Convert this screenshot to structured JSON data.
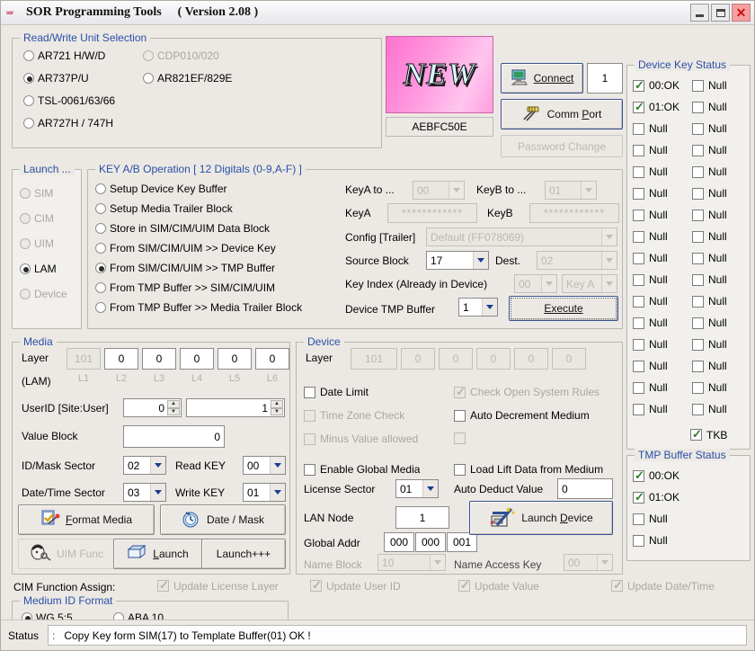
{
  "window": {
    "title": "SOR Programming Tools",
    "version": "( Version 2.08 )",
    "logo": "sor",
    "minimize": "minimize-icon",
    "maximize": "maximize-icon",
    "close": "✕"
  },
  "unit_selection": {
    "caption": "Read/Write Unit Selection",
    "options": [
      {
        "label": "AR721 H/W/D",
        "checked": false,
        "disabled": false
      },
      {
        "label": "AR737P/U",
        "checked": true,
        "disabled": false
      },
      {
        "label": "TSL-0061/63/66",
        "checked": false,
        "disabled": false
      },
      {
        "label": "AR727H / 747H",
        "checked": false,
        "disabled": false
      }
    ],
    "options_right": [
      {
        "label": "CDP010/020",
        "checked": false,
        "disabled": true
      },
      {
        "label": "AR821EF/829E",
        "checked": false,
        "disabled": false
      }
    ]
  },
  "device_panel": {
    "badge": "NEW",
    "serial": "AEBFC50E",
    "connect_label": "Connect",
    "connect_icon": "monitor-icon",
    "connect_value": "1",
    "commport_label": "Comm Port",
    "commport_icon": "plug-icon",
    "password_label": "Password Change"
  },
  "device_key_status": {
    "caption": "Device Key Status",
    "rows": [
      {
        "left": {
          "label": "00:OK",
          "checked": true
        },
        "right": {
          "label": "Null",
          "checked": false
        }
      },
      {
        "left": {
          "label": "01:OK",
          "checked": true
        },
        "right": {
          "label": "Null",
          "checked": false
        }
      },
      {
        "left": {
          "label": "Null",
          "checked": false
        },
        "right": {
          "label": "Null",
          "checked": false
        }
      },
      {
        "left": {
          "label": "Null",
          "checked": false
        },
        "right": {
          "label": "Null",
          "checked": false
        }
      },
      {
        "left": {
          "label": "Null",
          "checked": false
        },
        "right": {
          "label": "Null",
          "checked": false
        }
      },
      {
        "left": {
          "label": "Null",
          "checked": false
        },
        "right": {
          "label": "Null",
          "checked": false
        }
      },
      {
        "left": {
          "label": "Null",
          "checked": false
        },
        "right": {
          "label": "Null",
          "checked": false
        }
      },
      {
        "left": {
          "label": "Null",
          "checked": false
        },
        "right": {
          "label": "Null",
          "checked": false
        }
      },
      {
        "left": {
          "label": "Null",
          "checked": false
        },
        "right": {
          "label": "Null",
          "checked": false
        }
      },
      {
        "left": {
          "label": "Null",
          "checked": false
        },
        "right": {
          "label": "Null",
          "checked": false
        }
      },
      {
        "left": {
          "label": "Null",
          "checked": false
        },
        "right": {
          "label": "Null",
          "checked": false
        }
      },
      {
        "left": {
          "label": "Null",
          "checked": false
        },
        "right": {
          "label": "Null",
          "checked": false
        }
      },
      {
        "left": {
          "label": "Null",
          "checked": false
        },
        "right": {
          "label": "Null",
          "checked": false
        }
      },
      {
        "left": {
          "label": "Null",
          "checked": false
        },
        "right": {
          "label": "Null",
          "checked": false
        }
      },
      {
        "left": {
          "label": "Null",
          "checked": false
        },
        "right": {
          "label": "Null",
          "checked": false
        }
      },
      {
        "left": {
          "label": "Null",
          "checked": false
        },
        "right": {
          "label": "Null",
          "checked": false
        }
      }
    ],
    "tkb": {
      "label": "TKB",
      "checked": true
    }
  },
  "tmp_buffer_status": {
    "caption": "TMP Buffer Status",
    "rows": [
      {
        "label": "00:OK",
        "checked": true
      },
      {
        "label": "01:OK",
        "checked": true
      },
      {
        "label": "Null",
        "checked": false
      },
      {
        "label": "Null",
        "checked": false
      }
    ]
  },
  "launch": {
    "caption": "Launch ...",
    "options": [
      {
        "label": "SIM",
        "checked": false,
        "disabled": true
      },
      {
        "label": "CIM",
        "checked": false,
        "disabled": true
      },
      {
        "label": "UIM",
        "checked": false,
        "disabled": true
      },
      {
        "label": "LAM",
        "checked": true,
        "disabled": false
      },
      {
        "label": "Device",
        "checked": false,
        "disabled": true
      }
    ]
  },
  "key_ab": {
    "caption": "KEY A/B Operation   [ 12 Digitals (0-9,A-F) ]",
    "options": [
      {
        "label": "Setup Device Key Buffer",
        "checked": false
      },
      {
        "label": "Setup Media Trailer Block",
        "checked": false
      },
      {
        "label": "Store in SIM/CIM/UIM Data Block",
        "checked": false
      },
      {
        "label": "From SIM/CIM/UIM  >> Device Key",
        "checked": false
      },
      {
        "label": "From SIM/CIM/UIM  >> TMP Buffer",
        "checked": true
      },
      {
        "label": "From TMP Buffer >> SIM/CIM/UIM",
        "checked": false
      },
      {
        "label": "From TMP Buffer >> Media Trailer Block",
        "checked": false
      }
    ],
    "keya_to_label": "KeyA  to ...",
    "keya_to_value": "00",
    "keyb_to_label": "KeyB  to ...",
    "keyb_to_value": "01",
    "keya_label": "KeyA",
    "keya_value": "************",
    "keyb_label": "KeyB",
    "keyb_value": "************",
    "config_label": "Config [Trailer]",
    "config_value": "Default (FF078069)",
    "source_label": "Source Block",
    "source_value": "17",
    "dest_label": "Dest.",
    "dest_value": "02",
    "keyindex_label": "Key Index (Already in Device)",
    "keyindex_value": "00",
    "keytype_value": "Key A",
    "tmpbuffer_label": "Device TMP Buffer",
    "tmpbuffer_value": "1",
    "execute_label": "Execute"
  },
  "media": {
    "caption": "Media",
    "layer_label": "Layer",
    "lam_label": "(LAM)",
    "layer_cells": [
      {
        "value": "101",
        "disabled": true,
        "tag": "L1"
      },
      {
        "value": "0",
        "disabled": false,
        "tag": "L2"
      },
      {
        "value": "0",
        "disabled": false,
        "tag": "L3"
      },
      {
        "value": "0",
        "disabled": false,
        "tag": "L4"
      },
      {
        "value": "0",
        "disabled": false,
        "tag": "L5"
      },
      {
        "value": "0",
        "disabled": false,
        "tag": "L6"
      }
    ],
    "userid_label": "UserID [Site:User]",
    "userid_site": "0",
    "userid_user": "1",
    "valueblock_label": "Value Block",
    "valueblock_value": "0",
    "idmask_label": "ID/Mask Sector",
    "idmask_value": "02",
    "readkey_label": "Read KEY",
    "readkey_value": "00",
    "datetime_label": "Date/Time Sector",
    "datetime_value": "03",
    "writekey_label": "Write KEY",
    "writekey_value": "01",
    "format_media_label": "Format Media",
    "format_media_icon": "form-check-icon",
    "date_mask_label": "Date / Mask",
    "date_mask_icon": "clock-icon",
    "uim_func_label": "UIM Func",
    "uim_func_icon": "face-key-icon",
    "launch_label": "Launch",
    "launch_icon": "window-icon",
    "launch_plus_label": "Launch+++"
  },
  "device": {
    "caption": "Device",
    "layer_label": "Layer",
    "layer_cells": [
      {
        "value": "101",
        "disabled": true
      },
      {
        "value": "0",
        "disabled": true
      },
      {
        "value": "0",
        "disabled": true
      },
      {
        "value": "0",
        "disabled": true
      },
      {
        "value": "0",
        "disabled": true
      },
      {
        "value": "0",
        "disabled": true
      }
    ],
    "checks_left": [
      {
        "label": "Date Limit",
        "checked": false,
        "disabled": false
      },
      {
        "label": "Time Zone Check",
        "checked": false,
        "disabled": true
      },
      {
        "label": "Minus Value allowed",
        "checked": false,
        "disabled": true
      },
      {
        "label": "Enable Global Media",
        "checked": false,
        "disabled": false
      }
    ],
    "checks_right": [
      {
        "label": "Check Open System Rules",
        "checked": true,
        "disabled": true
      },
      {
        "label": "Auto Decrement Medium",
        "checked": false,
        "disabled": false
      },
      {
        "label": "",
        "checked": false,
        "disabled": true
      },
      {
        "label": "Load Lift Data from Medium",
        "checked": false,
        "disabled": false
      }
    ],
    "license_label": "License Sector",
    "license_value": "01",
    "autodeduct_label": "Auto Deduct Value",
    "autodeduct_value": "0",
    "lannode_label": "LAN Node",
    "lannode_value": "1",
    "globaladdr_label": "Global Addr",
    "globaladdr": [
      "000",
      "000",
      "001"
    ],
    "nameblock_label": "Name Block",
    "nameblock_value": "10",
    "nameaccess_label": "Name Access Key",
    "nameaccess_value": "00",
    "launch_device_label": "Launch Device",
    "launch_device_icon": "wand-card-icon"
  },
  "cim_function": {
    "label": "CIM Function Assign:",
    "items": [
      {
        "label": "Update License Layer",
        "checked": true,
        "disabled": true
      },
      {
        "label": "Update User ID",
        "checked": true,
        "disabled": true
      },
      {
        "label": "Update Value",
        "checked": true,
        "disabled": true
      },
      {
        "label": "Update Date/Time",
        "checked": true,
        "disabled": true
      }
    ]
  },
  "medium_id_format": {
    "caption": "Medium ID Format",
    "options": [
      {
        "label": "WG 5:5",
        "checked": true
      },
      {
        "label": "ABA 10",
        "checked": false
      }
    ]
  },
  "status": {
    "label": "Status",
    "colon": ":",
    "message": "Copy Key form SIM(17) to Template Buffer(01) OK !"
  }
}
